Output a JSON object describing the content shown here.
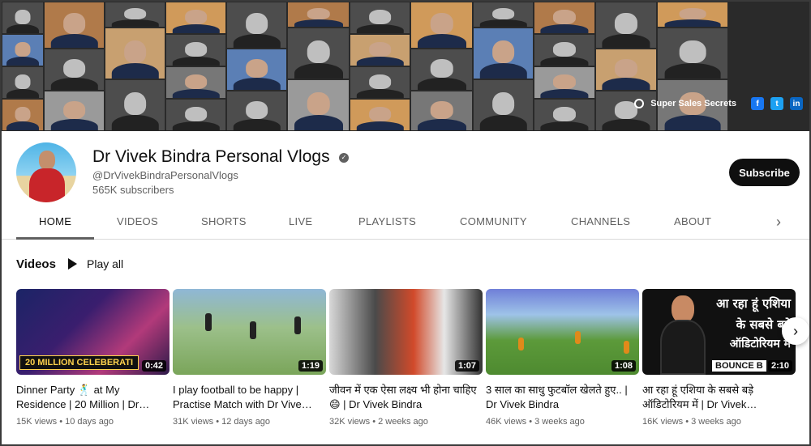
{
  "banner": {
    "brand_text": "Super Sales Secrets",
    "social": [
      "f",
      "t",
      "in"
    ]
  },
  "channel": {
    "name": "Dr Vivek Bindra Personal Vlogs",
    "verified_mark": "✓",
    "handle": "@DrVivekBindraPersonalVlogs",
    "subscribers": "565K subscribers",
    "subscribe_label": "Subscribe"
  },
  "tabs": [
    {
      "label": "HOME"
    },
    {
      "label": "VIDEOS"
    },
    {
      "label": "SHORTS"
    },
    {
      "label": "LIVE"
    },
    {
      "label": "PLAYLISTS"
    },
    {
      "label": "COMMUNITY"
    },
    {
      "label": "CHANNELS"
    },
    {
      "label": "ABOUT"
    }
  ],
  "tabs_next_glyph": "›",
  "section": {
    "title": "Videos",
    "play_all": "Play all"
  },
  "videos": [
    {
      "title": "Dinner Party 🕺 at My Residence | 20 Million | Dr…",
      "views": "15K views",
      "age": "10 days ago",
      "duration": "0:42",
      "thumb_caption": "20 MILLION CELEBERATI"
    },
    {
      "title": "I play football to be happy | Practise Match with Dr Vive…",
      "views": "31K views",
      "age": "12 days ago",
      "duration": "1:19"
    },
    {
      "title": "जीवन में एक ऐसा लक्ष्य भी होना चाहिए 😄 | Dr Vivek Bindra",
      "views": "32K views",
      "age": "2 weeks ago",
      "duration": "1:07"
    },
    {
      "title": "3 साल का साधु फुटबॉल खेलते हुए.. | Dr Vivek Bindra",
      "views": "46K views",
      "age": "3 weeks ago",
      "duration": "1:08"
    },
    {
      "title": "आ रहा हूं एशिया के सबसे बड़े ऑडिटोरियम में | Dr Vivek…",
      "views": "16K views",
      "age": "3 weeks ago",
      "duration": "2:10",
      "thumb_lines": [
        "आ रहा हूं एशिया",
        "के सबसे बड़े",
        "ऑडिटोरियम मे"
      ],
      "thumb_badge": "BOUNCE B"
    }
  ],
  "carousel_next_glyph": "›",
  "colors": {
    "text_primary": "#0f0f0f",
    "text_secondary": "#606060",
    "subscribe_bg": "#0f0f0f"
  }
}
